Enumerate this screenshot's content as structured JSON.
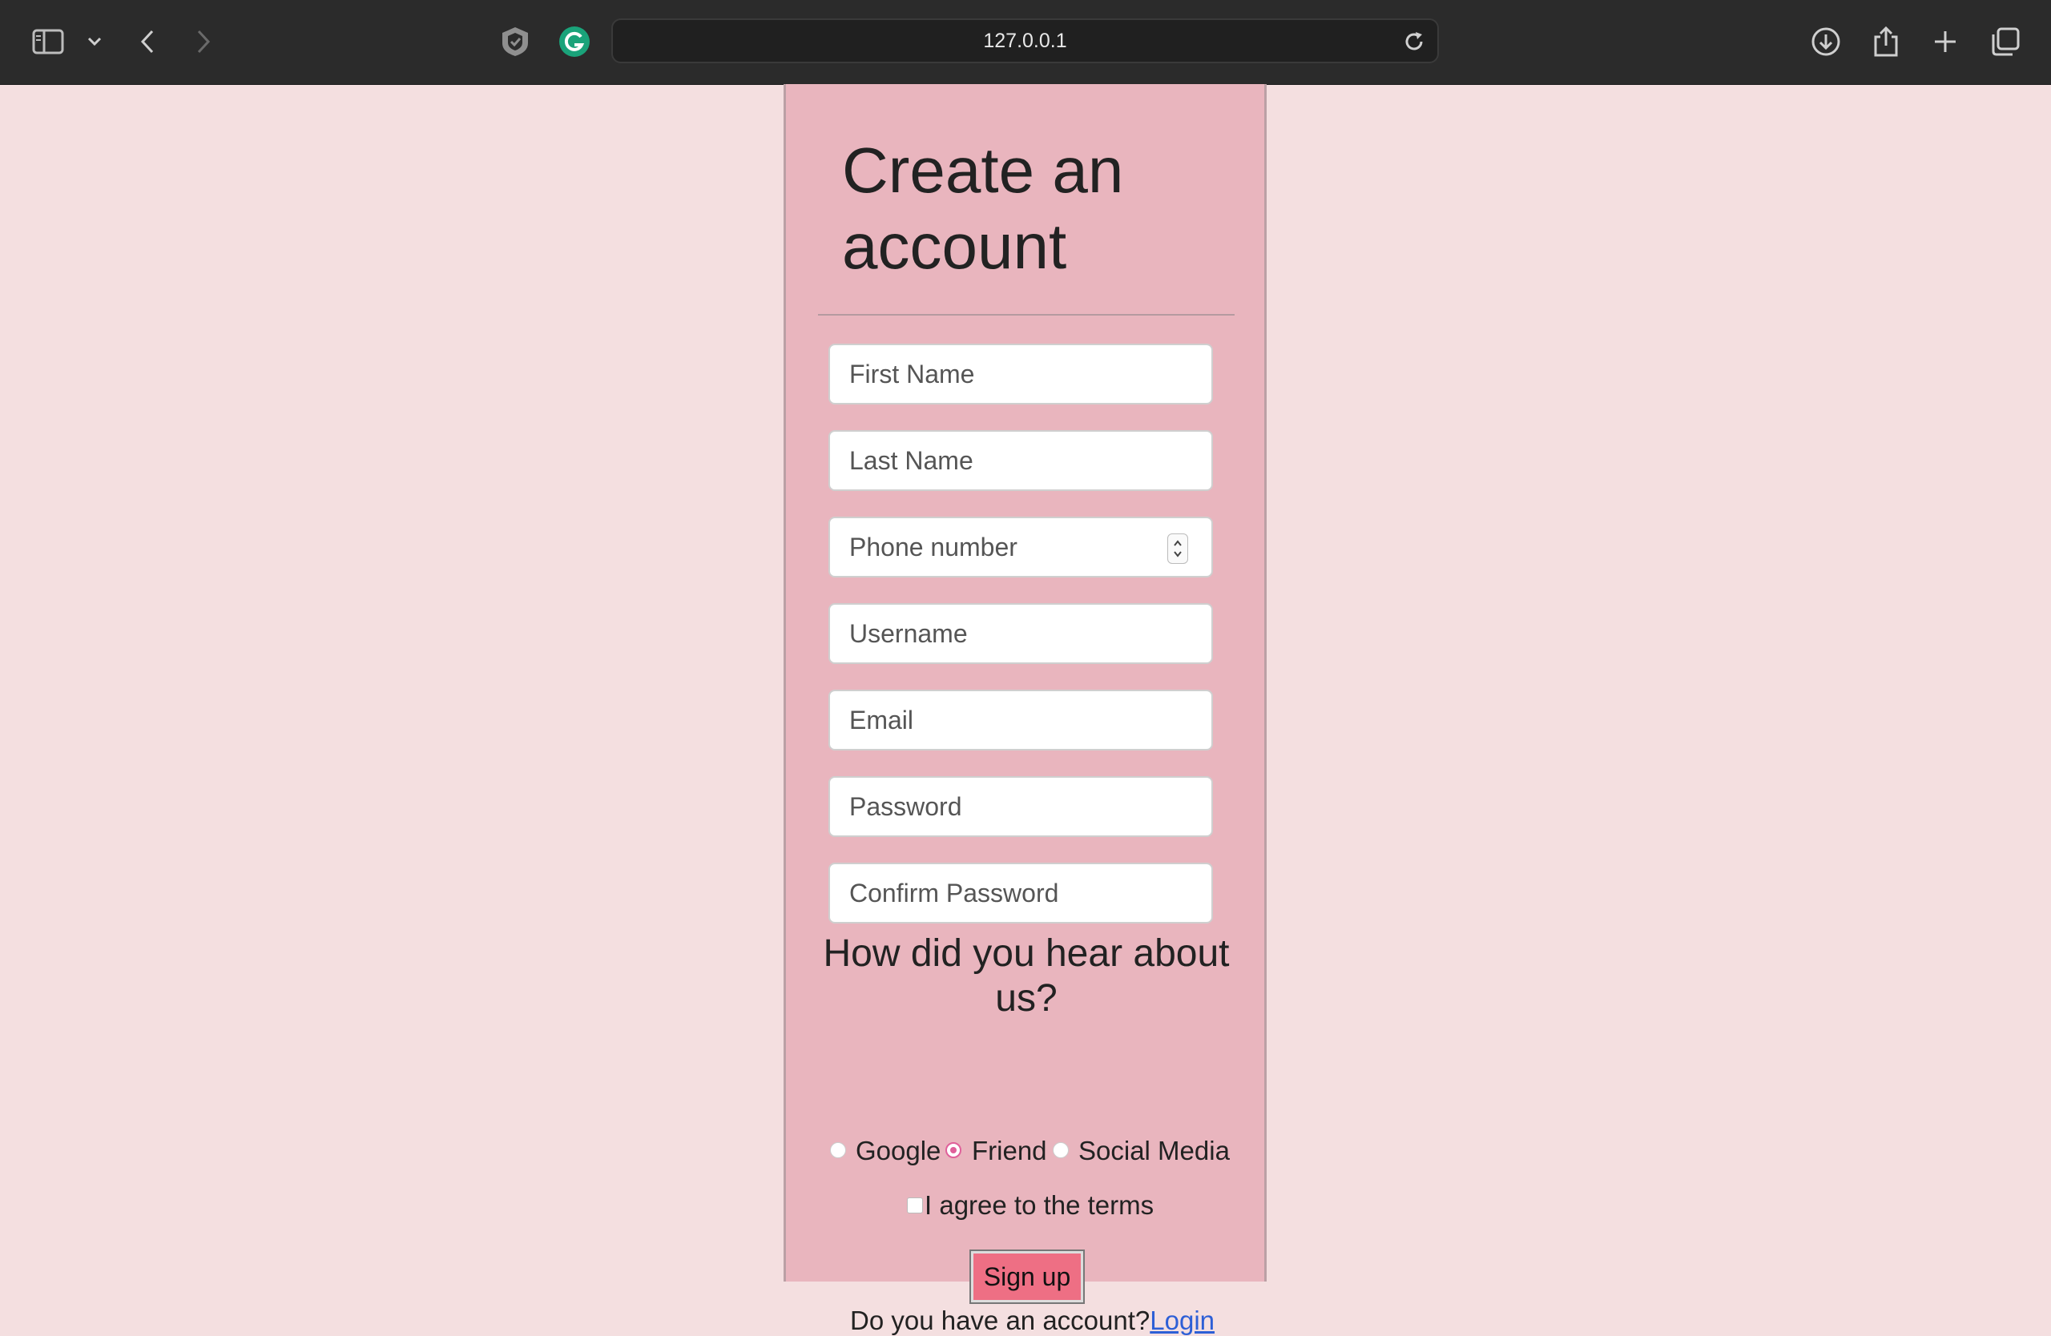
{
  "browser": {
    "url": "127.0.0.1"
  },
  "form": {
    "title": "Create an account",
    "fields": {
      "first_name": "First Name",
      "last_name": "Last Name",
      "phone": "Phone number",
      "username": "Username",
      "email": "Email",
      "password": "Password",
      "confirm_password": "Confirm Password"
    },
    "question": "How did you hear about us?",
    "options": [
      "Google",
      "Friend",
      "Social Media"
    ],
    "selected_option": "Friend",
    "terms_label": "I agree to the terms",
    "terms_checked": false,
    "signup_label": "Sign up",
    "login_prompt": "Do you have an account?",
    "login_link": "Login"
  },
  "colors": {
    "page_bg": "#f4dfe0",
    "card_bg": "#e9b5be",
    "button_bg": "#ee6f84",
    "link": "#2d5fd6",
    "radio_accent": "#e0609a"
  }
}
